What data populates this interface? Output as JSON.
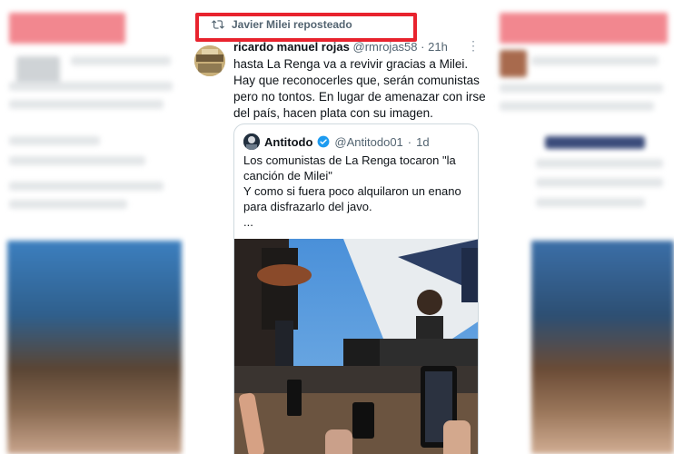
{
  "repost": {
    "label": "Javier Milei reposteado"
  },
  "tweet": {
    "author_name": "ricardo manuel rojas",
    "handle": "@rmrojas58",
    "time": "21h",
    "more_glyph": "⋮",
    "text": "hasta La Renga va a revivir gracias a Milei. Hay que reconocerles que, serán comunistas pero no tontos. En lugar de amenazar con irse del país, hacen plata con su imagen."
  },
  "quote": {
    "author_name": "Antitodo",
    "handle": "@Antitodo01",
    "time": "1d",
    "lines": [
      "Los comunistas de La Renga tocaron \"la",
      "canción de Milei\"",
      "Y como si fuera poco alquilaron un enano",
      "para disfrazarlo del javo.",
      "..."
    ]
  },
  "colors": {
    "highlight": "#e8232e",
    "verified": "#1d9bf0",
    "secondary_text": "#536471"
  }
}
